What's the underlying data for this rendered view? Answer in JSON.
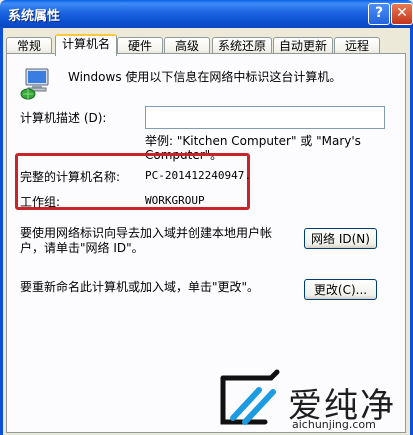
{
  "window": {
    "title": "系统属性",
    "help_glyph": "?",
    "close_glyph": "✕"
  },
  "tabs": [
    {
      "label": "常规",
      "active": false
    },
    {
      "label": "计算机名",
      "active": true
    },
    {
      "label": "硬件",
      "active": false
    },
    {
      "label": "高级",
      "active": false
    },
    {
      "label": "系统还原",
      "active": false
    },
    {
      "label": "自动更新",
      "active": false
    },
    {
      "label": "远程",
      "active": false
    }
  ],
  "content": {
    "intro": "Windows 使用以下信息在网络中标识这台计算机。",
    "description_label": "计算机描述 (D):",
    "description_value": "",
    "example_line1": "举例: \"Kitchen Computer\" 或 \"Mary's",
    "example_line2": "Computer\"。",
    "full_name_label": "完整的计算机名称:",
    "full_name_value": "PC-201412240947.",
    "workgroup_label": "工作组:",
    "workgroup_value": "WORKGROUP",
    "network_text_line1": "要使用网络标识向导去加入域并创建本地用户帐",
    "network_text_line2": "户，请单击\"网络 ID\"。",
    "network_button": "网络 ID(N)",
    "rename_text": "要重新命名此计算机或加入域，单击\"更改\"。",
    "change_button": "更改(C)..."
  },
  "watermark": {
    "brand": "爱纯净",
    "url": "aichunjing.com"
  },
  "colors": {
    "highlight_box": "#c8252b",
    "titlebar": "#0c4fd0"
  }
}
